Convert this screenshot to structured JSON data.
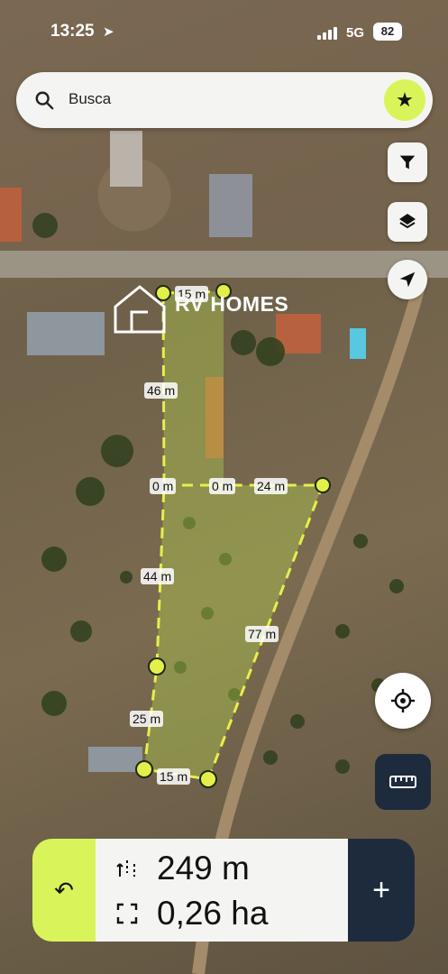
{
  "status": {
    "time": "13:25",
    "network": "5G",
    "battery": "82"
  },
  "search": {
    "placeholder": "Busca"
  },
  "brand": {
    "name": "RV HOMES"
  },
  "segments": [
    {
      "label": "15 m"
    },
    {
      "label": "46 m"
    },
    {
      "label": "0 m"
    },
    {
      "label": "0 m"
    },
    {
      "label": "24 m"
    },
    {
      "label": "44 m"
    },
    {
      "label": "77 m"
    },
    {
      "label": "25 m"
    },
    {
      "label": "15 m"
    }
  ],
  "measure": {
    "distance": "249 m",
    "area": "0,26 ha"
  },
  "colors": {
    "accent": "#d9f45a",
    "dark": "#1e2b3d",
    "polygon_line": "#e4f04a"
  },
  "icons": [
    "search-icon",
    "star-icon",
    "filter-icon",
    "layers-icon",
    "navigate-icon",
    "crosshair-icon",
    "ruler-icon",
    "undo-icon",
    "distance-icon",
    "area-icon",
    "plus-icon"
  ]
}
